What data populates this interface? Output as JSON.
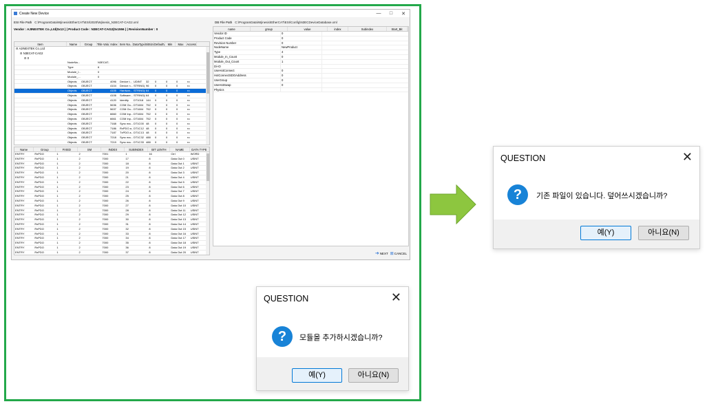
{
  "window": {
    "title": "Create New Device",
    "ctrl_min": "—",
    "ctrl_max": "□",
    "ctrl_close": "✕",
    "esi_label": "ESI File Path",
    "esi_path": "C:\\ProgramData\\Wjinesis\\EtherCAT\\ESI\\2020\\Wjinesis_N3ECAT-CAG2.xml",
    "dd_label": "DB File Path",
    "dd_path": "C:\\ProgramData\\Wjinesis\\EtherCAT\\ESI\\Config\\N3ECDeviceDatabase.xml",
    "vendor_line": "Vendor : AJINEXTEK Co.,Ltd(0x13 ) | Product Code : N3ECAT-CAG2(0x1556 ) | RevisionNumber : 0"
  },
  "tree": {
    "headers": [
      "Item",
      "Name",
      "Group",
      "Title Value",
      "Index",
      "Item Na..",
      "DataType",
      "BitSize",
      "DefaultV..",
      "Min",
      "Max",
      "Access"
    ],
    "nodes": [
      "AJINEXTEK Co.,Ltd",
      "N3ECAT-CAG2",
      "0"
    ],
    "rows": [
      [
        "",
        "NodeNa...",
        "",
        "N3ECAT...",
        "",
        "",
        "",
        "",
        "",
        "",
        "",
        ""
      ],
      [
        "",
        "Type",
        "",
        "6",
        "",
        "",
        "",
        "",
        "",
        "",
        "",
        ""
      ],
      [
        "",
        "Module_I...",
        "",
        "0",
        "",
        "",
        "",
        "",
        "",
        "",
        "",
        ""
      ],
      [
        "",
        "Module_...",
        "",
        "0",
        "",
        "",
        "",
        "",
        "",
        "",
        "",
        ""
      ],
      [
        "",
        "Objects",
        "OBJECT",
        "",
        "4096",
        "Device t...",
        "UDINT",
        "32",
        "0",
        "0",
        "0",
        "ro"
      ],
      [
        "",
        "Objects",
        "OBJECT",
        "",
        "4104",
        "Device n...",
        "STRING(..",
        "96",
        "0",
        "0",
        "0",
        "ro"
      ],
      [
        "",
        "Objects",
        "OBJECT",
        "",
        "4105",
        "Hardwar...",
        "STRING(6)",
        "64",
        "0",
        "0",
        "0",
        "ro"
      ],
      [
        "",
        "Objects",
        "OBJECT",
        "",
        "4106",
        "Software...",
        "STRING(6)",
        "64",
        "0",
        "0",
        "0",
        "ro"
      ],
      [
        "",
        "Objects",
        "OBJECT",
        "",
        "4120",
        "Identity",
        "DT1018",
        "144",
        "0",
        "0",
        "0",
        "ro"
      ],
      [
        "",
        "Objects",
        "OBJECT",
        "",
        "5636",
        "COM Ou...",
        "DT1604",
        "752",
        "0",
        "0",
        "0",
        "ro"
      ],
      [
        "",
        "Objects",
        "OBJECT",
        "",
        "5637",
        "COM Ou...",
        "DT1604",
        "752",
        "0",
        "0",
        "0",
        "ro"
      ],
      [
        "",
        "Objects",
        "OBJECT",
        "",
        "6660",
        "COM Inp...",
        "DT1604",
        "752",
        "0",
        "0",
        "0",
        "ro"
      ],
      [
        "",
        "Objects",
        "OBJECT",
        "",
        "6661",
        "COM Inp...",
        "DT1604",
        "752",
        "0",
        "0",
        "0",
        "ro"
      ],
      [
        "",
        "Objects",
        "OBJECT",
        "",
        "7168",
        "Sync ma...",
        "DT1C00",
        "48",
        "0",
        "0",
        "0",
        "ro"
      ],
      [
        "",
        "Objects",
        "OBJECT",
        "",
        "7186",
        "RxPDO a...",
        "DT1C12",
        "48",
        "0",
        "0",
        "0",
        "ro"
      ],
      [
        "",
        "Objects",
        "OBJECT",
        "",
        "7187",
        "TxPDO a...",
        "DT1C13",
        "48",
        "0",
        "0",
        "0",
        "ro"
      ],
      [
        "",
        "Objects",
        "OBJECT",
        "",
        "7218",
        "Sync ma...",
        "DT1C32",
        "488",
        "0",
        "0",
        "0",
        "ro"
      ],
      [
        "",
        "Objects",
        "OBJECT",
        "",
        "7219",
        "Sync ma...",
        "DT1C33",
        "488",
        "0",
        "0",
        "0",
        "ro"
      ]
    ]
  },
  "pdo": {
    "headers": [
      "Name",
      "Group",
      "FIXED",
      "SM",
      "INDEX",
      "SUBINDEX",
      "BIT LENTH",
      "NAME",
      "DATA TYPE"
    ],
    "rows": [
      [
        "ENTRY",
        "RxPDO",
        "1",
        "2",
        "7001",
        "1",
        "16",
        "Ctrl",
        "WORD"
      ],
      [
        "ENTRY",
        "RxPDO",
        "1",
        "2",
        "7000",
        "17",
        "8",
        "Data Out 0",
        "USINT"
      ],
      [
        "ENTRY",
        "RxPDO",
        "1",
        "2",
        "7000",
        "18",
        "8",
        "Data Out 1",
        "USINT"
      ],
      [
        "ENTRY",
        "RxPDO",
        "1",
        "2",
        "7000",
        "19",
        "8",
        "Data Out 2",
        "USINT"
      ],
      [
        "ENTRY",
        "RxPDO",
        "1",
        "2",
        "7000",
        "20",
        "8",
        "Data Out 3",
        "USINT"
      ],
      [
        "ENTRY",
        "RxPDO",
        "1",
        "2",
        "7000",
        "21",
        "8",
        "Data Out 4",
        "USINT"
      ],
      [
        "ENTRY",
        "RxPDO",
        "1",
        "2",
        "7000",
        "22",
        "8",
        "Data Out 5",
        "USINT"
      ],
      [
        "ENTRY",
        "RxPDO",
        "1",
        "2",
        "7000",
        "23",
        "8",
        "Data Out 6",
        "USINT"
      ],
      [
        "ENTRY",
        "RxPDO",
        "1",
        "2",
        "7000",
        "24",
        "8",
        "Data Out 7",
        "USINT"
      ],
      [
        "ENTRY",
        "RxPDO",
        "1",
        "2",
        "7000",
        "25",
        "8",
        "Data Out 8",
        "USINT"
      ],
      [
        "ENTRY",
        "RxPDO",
        "1",
        "2",
        "7000",
        "26",
        "8",
        "Data Out 9",
        "USINT"
      ],
      [
        "ENTRY",
        "RxPDO",
        "1",
        "2",
        "7000",
        "27",
        "8",
        "Data Out 10",
        "USINT"
      ],
      [
        "ENTRY",
        "RxPDO",
        "1",
        "2",
        "7000",
        "28",
        "8",
        "Data Out 11",
        "USINT"
      ],
      [
        "ENTRY",
        "RxPDO",
        "1",
        "2",
        "7000",
        "29",
        "8",
        "Data Out 12",
        "USINT"
      ],
      [
        "ENTRY",
        "RxPDO",
        "1",
        "2",
        "7000",
        "30",
        "8",
        "Data Out 13",
        "USINT"
      ],
      [
        "ENTRY",
        "RxPDO",
        "1",
        "2",
        "7000",
        "31",
        "8",
        "Data Out 14",
        "USINT"
      ],
      [
        "ENTRY",
        "RxPDO",
        "1",
        "2",
        "7000",
        "32",
        "8",
        "Data Out 15",
        "USINT"
      ],
      [
        "ENTRY",
        "RxPDO",
        "1",
        "2",
        "7000",
        "33",
        "8",
        "Data Out 16",
        "USINT"
      ],
      [
        "ENTRY",
        "RxPDO",
        "1",
        "2",
        "7000",
        "34",
        "8",
        "Data Out 17",
        "USINT"
      ],
      [
        "ENTRY",
        "RxPDO",
        "1",
        "2",
        "7000",
        "35",
        "8",
        "Data Out 18",
        "USINT"
      ],
      [
        "ENTRY",
        "RxPDO",
        "1",
        "2",
        "7000",
        "36",
        "8",
        "Data Out 19",
        "USINT"
      ],
      [
        "ENTRY",
        "RxPDO",
        "1",
        "2",
        "7000",
        "37",
        "8",
        "Data Out 20",
        "USINT"
      ],
      [
        "ENTRY",
        "RxPDO",
        "1",
        "2",
        "7000",
        "38",
        "8",
        "Data Out 21",
        "USINT"
      ]
    ]
  },
  "props": {
    "headers": [
      "name",
      "group",
      "value",
      "index",
      "Subindex",
      "Start_Bit",
      "Bit_Size"
    ],
    "rows": [
      [
        "Vendor ID",
        "0"
      ],
      [
        "Product Code",
        "0"
      ],
      [
        "Revision Number",
        "0"
      ],
      [
        "NodeName",
        "NewProduct"
      ],
      [
        "Type",
        "4"
      ],
      [
        "Module_In_Count",
        "0"
      ],
      [
        "Module_Out_Count",
        "1"
      ],
      [
        "Di-IO",
        ""
      ],
      [
        "UseHotConnect",
        "0"
      ],
      [
        "HotConnectSDOAddress",
        "0"
      ],
      [
        "UseGroup",
        "0"
      ],
      [
        "UseHotSwap",
        "0"
      ],
      [
        "Physics",
        ""
      ]
    ]
  },
  "buttons": {
    "next": "NEXT",
    "cancel": "CANCEL"
  },
  "dialog1": {
    "title": "QUESTION",
    "close": "✕",
    "icon": "?",
    "message": "모듈을 추가하시겠습니까?",
    "yes": "예(Y)",
    "no": "아니요(N)"
  },
  "dialog2": {
    "title": "QUESTION",
    "close": "✕",
    "icon": "?",
    "message": "기존 파일이 있습니다. 덮어쓰시겠습니까?",
    "yes": "예(Y)",
    "no": "아니요(N)"
  },
  "colors": {
    "frame": "#23a84a",
    "arrow": "#8dc63f",
    "selection": "#0a6bd6",
    "question_icon": "#1883d7"
  }
}
